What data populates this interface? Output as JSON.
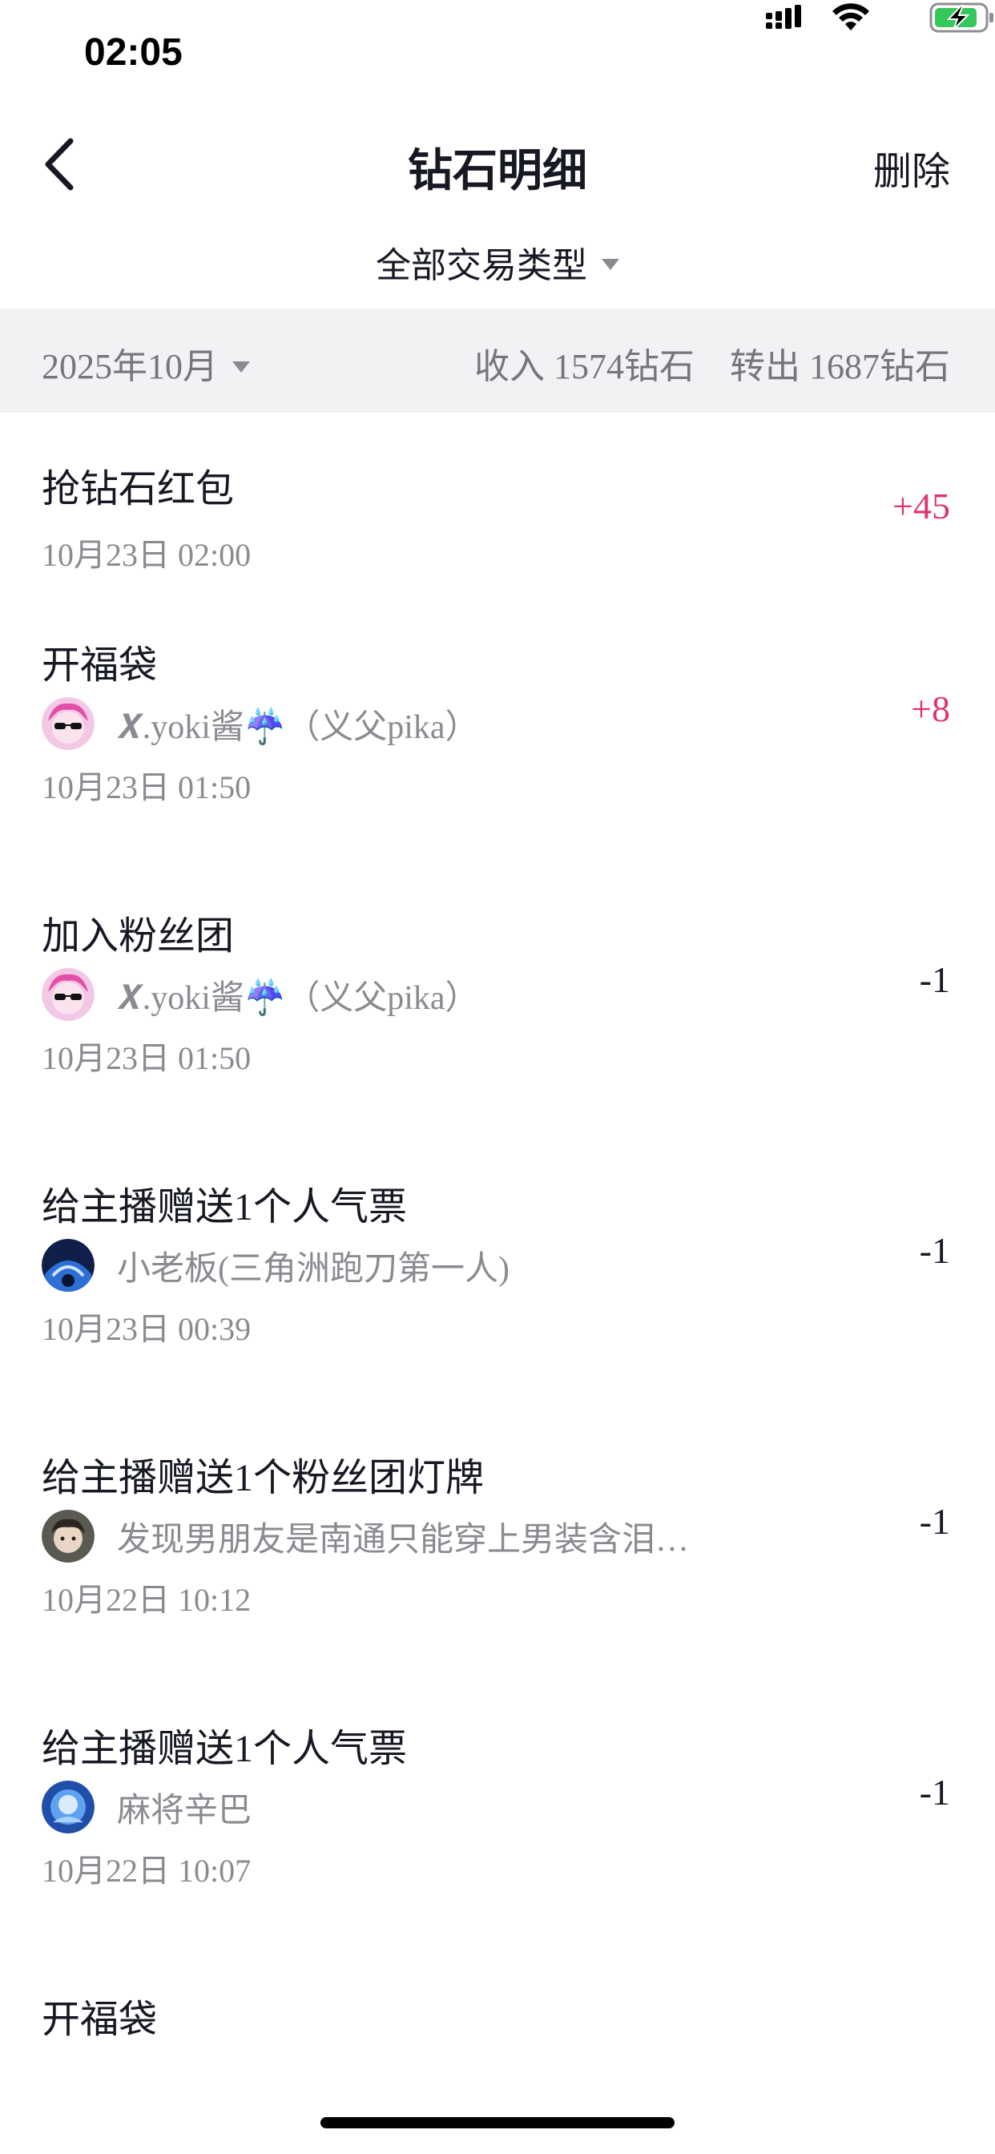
{
  "status_bar": {
    "time": "02:05",
    "icons": [
      "signal-icon",
      "wifi-icon",
      "battery-charging-icon"
    ],
    "battery_color": "#34c759"
  },
  "nav": {
    "back_icon": "chevron-left-icon",
    "title": "钻石明细",
    "delete_label": "删除"
  },
  "filter": {
    "type_label": "全部交易类型"
  },
  "summary": {
    "month": "2025年10月",
    "income": "收入 1574钻石",
    "outgo": "转出 1687钻石"
  },
  "colors": {
    "positive": "#e0336e",
    "negative": "#161823",
    "secondary_text": "#8a8b91",
    "summary_bg": "#f2f2f4"
  },
  "transactions": [
    {
      "title": "抢钻石红包",
      "user": "",
      "time": "10月23日 02:00",
      "amount": "+45"
    },
    {
      "title": "开福袋",
      "user": "𝑿.yoki酱☔（义父pika）",
      "time": "10月23日 01:50",
      "amount": "+8"
    },
    {
      "title": "加入粉丝团",
      "user": "𝑿.yoki酱☔（义父pika）",
      "time": "10月23日 01:50",
      "amount": "-1"
    },
    {
      "title": "给主播赠送1个人气票",
      "user": "小老板(三角洲跑刀第一人)",
      "time": "10月23日 00:39",
      "amount": "-1"
    },
    {
      "title": "给主播赠送1个粉丝团灯牌",
      "user": "发现男朋友是南通只能穿上男装含泪…",
      "time": "10月22日 10:12",
      "amount": "-1"
    },
    {
      "title": "给主播赠送1个人气票",
      "user": "麻将辛巴",
      "time": "10月22日 10:07",
      "amount": "-1"
    },
    {
      "title": "开福袋",
      "user": "",
      "time": "",
      "amount": ""
    }
  ]
}
